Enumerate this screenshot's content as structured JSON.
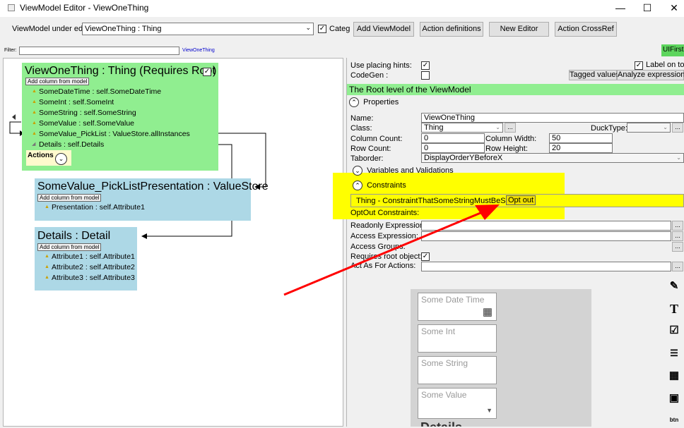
{
  "window": {
    "title": "ViewModel Editor - ViewOneThing",
    "minimize": "—",
    "maximize": "☐",
    "close": "✕"
  },
  "toolbar": {
    "vm_label": "ViewModel under edit:",
    "vm_value": "ViewOneThing : Thing",
    "categ_label": "Categ",
    "add_viewmodel": "Add ViewModel",
    "action_definitions": "Action definitions",
    "new_editor": "New Editor",
    "action_crossref": "Action CrossRef"
  },
  "filter": {
    "label": "Filter:",
    "link": "ViewOneThing",
    "uifirst": "UIFirst"
  },
  "diagram": {
    "root": {
      "title": "ViewOneThing : Thing  (Requires Root",
      "add_column": "Add column from model",
      "rows": [
        "SomeDateTime : self.SomeDateTime",
        "SomeInt : self.SomeInt",
        "SomeString : self.SomeString",
        "SomeValue : self.SomeValue",
        "SomeValue_PickList : ValueStore.allInstances",
        "Details : self.Details"
      ],
      "actions": "Actions"
    },
    "picklist": {
      "title": "SomeValue_PickListPresentation : ValueStore",
      "add_column": "Add column from model",
      "rows": [
        "Presentation : self.Attribute1"
      ]
    },
    "details": {
      "title": "Details : Detail",
      "add_column": "Add column from model",
      "rows": [
        "Attribute1 : self.Attribute1",
        "Attribute2 : self.Attribute2",
        "Attribute3 : self.Attribute3"
      ]
    }
  },
  "props": {
    "use_placing_hints": "Use placing hints:",
    "codegen": "CodeGen :",
    "label_on_top": "Label on top",
    "tagged_values": "Tagged values",
    "analyze_expressions": "Analyze expressions",
    "root_level": "The Root level of the ViewModel",
    "properties": "Properties",
    "name_label": "Name:",
    "name_value": "ViewOneThing",
    "class_label": "Class:",
    "class_value": "Thing",
    "ducktype_label": "DuckType:",
    "colcount_label": "Column Count:",
    "colcount_value": "0",
    "colwidth_label": "Column Width:",
    "colwidth_value": "50",
    "rowcount_label": "Row Count:",
    "rowcount_value": "0",
    "rowheight_label": "Row Height:",
    "rowheight_value": "20",
    "taborder_label": "Taborder:",
    "taborder_value": "DisplayOrderYBeforeX",
    "variables": "Variables and Validations",
    "constraints": "Constraints",
    "constraint_item": "Thing - ConstraintThatSomeStringMustBeSet -",
    "opt_out": "Opt out",
    "optout_constraints": "OptOut Constraints:",
    "readonly_expr": "Readonly Expression:",
    "access_expr": "Access Expression:",
    "access_groups": "Access Groups:",
    "requires_root": "Requires root object:",
    "act_as": "Act As For Actions:",
    "dots": "..."
  },
  "preview": {
    "fields": [
      "Some Date Time",
      "Some Int",
      "Some String",
      "Some Value"
    ],
    "details_label": "Details"
  },
  "colors": {
    "green": "#90ee90",
    "blue": "#add8e6",
    "highlight": "#ffff00",
    "arrow": "#ff0000"
  }
}
